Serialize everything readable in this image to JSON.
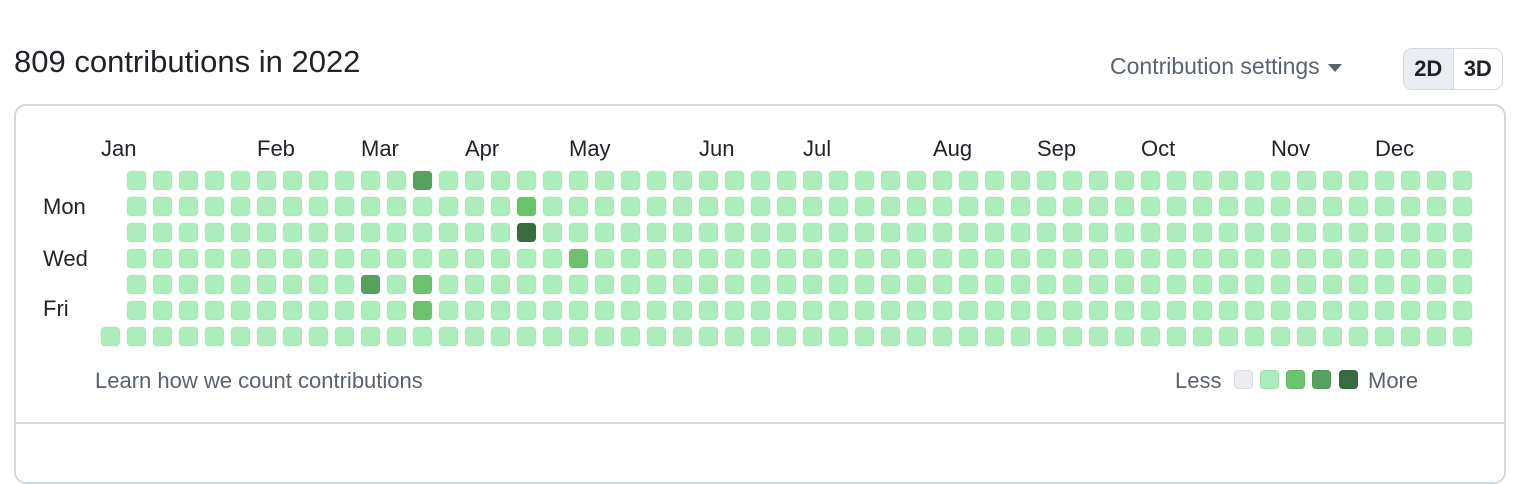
{
  "header": {
    "title": "809 contributions in 2022",
    "settings_label": "Contribution settings",
    "view_options": [
      "2D",
      "3D"
    ],
    "view_selected": "2D"
  },
  "calendar": {
    "months": [
      "Jan",
      "Feb",
      "Mar",
      "Apr",
      "May",
      "Jun",
      "Jul",
      "Aug",
      "Sep",
      "Oct",
      "Nov",
      "Dec"
    ],
    "day_labels": [
      "Mon",
      "Wed",
      "Fri"
    ],
    "colors": [
      "#ebedf0",
      "#aceebb",
      "#6bc46d",
      "#55a15e",
      "#386c3e"
    ],
    "default_level": 1,
    "highlights": [
      {
        "week": 16,
        "day": 1,
        "level": 2
      },
      {
        "week": 16,
        "day": 2,
        "level": 4
      },
      {
        "week": 18,
        "day": 3,
        "level": 2
      },
      {
        "week": 10,
        "day": 4,
        "level": 3
      },
      {
        "week": 12,
        "day": 4,
        "level": 2
      },
      {
        "week": 12,
        "day": 5,
        "level": 2
      },
      {
        "week": 12,
        "day": 0,
        "level": 3
      }
    ]
  },
  "footer": {
    "learn_link": "Learn how we count contributions",
    "legend_less": "Less",
    "legend_more": "More"
  }
}
